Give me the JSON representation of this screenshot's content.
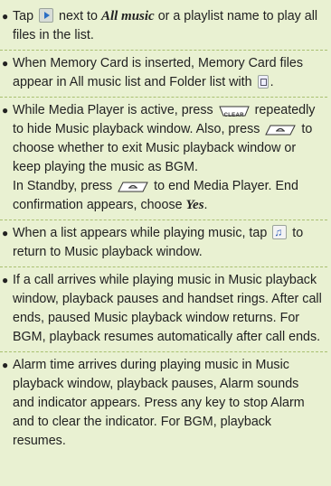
{
  "notes": [
    {
      "parts": [
        "Tap",
        "next to",
        "All music",
        "or a playlist name to play all files in the list."
      ],
      "icons": [
        "play-icon"
      ]
    },
    {
      "parts": [
        "When Memory Card is inserted, Memory Card files appear in All music list and Folder list with",
        "."
      ],
      "icons": [
        "memory-card-file-icon"
      ]
    },
    {
      "parts": [
        "While Media Player is active, press",
        "repeatedly to hide Music playback window. Also, press",
        "to choose whether to exit Music playback window or keep playing the music as BGM.",
        "In Standby, press",
        "to end Media Player. End confirmation appears, choose",
        "Yes",
        "."
      ],
      "keys": [
        "CLEAR",
        ""
      ]
    },
    {
      "parts": [
        "When a list appears while playing music, tap",
        "to return to Music playback window."
      ],
      "icons": [
        "music-note-icon"
      ]
    },
    {
      "text": "If a call arrives while playing music in Music playback window, playback pauses and handset rings. After call ends, paused Music playback window returns. For BGM, playback resumes automatically after call ends."
    },
    {
      "text": "Alarm time arrives during playing music in Music playback window, playback pauses, Alarm sounds and indicator appears. Press any key to stop Alarm and to clear the indicator. For BGM, playback resumes."
    }
  ],
  "bullet": "●"
}
